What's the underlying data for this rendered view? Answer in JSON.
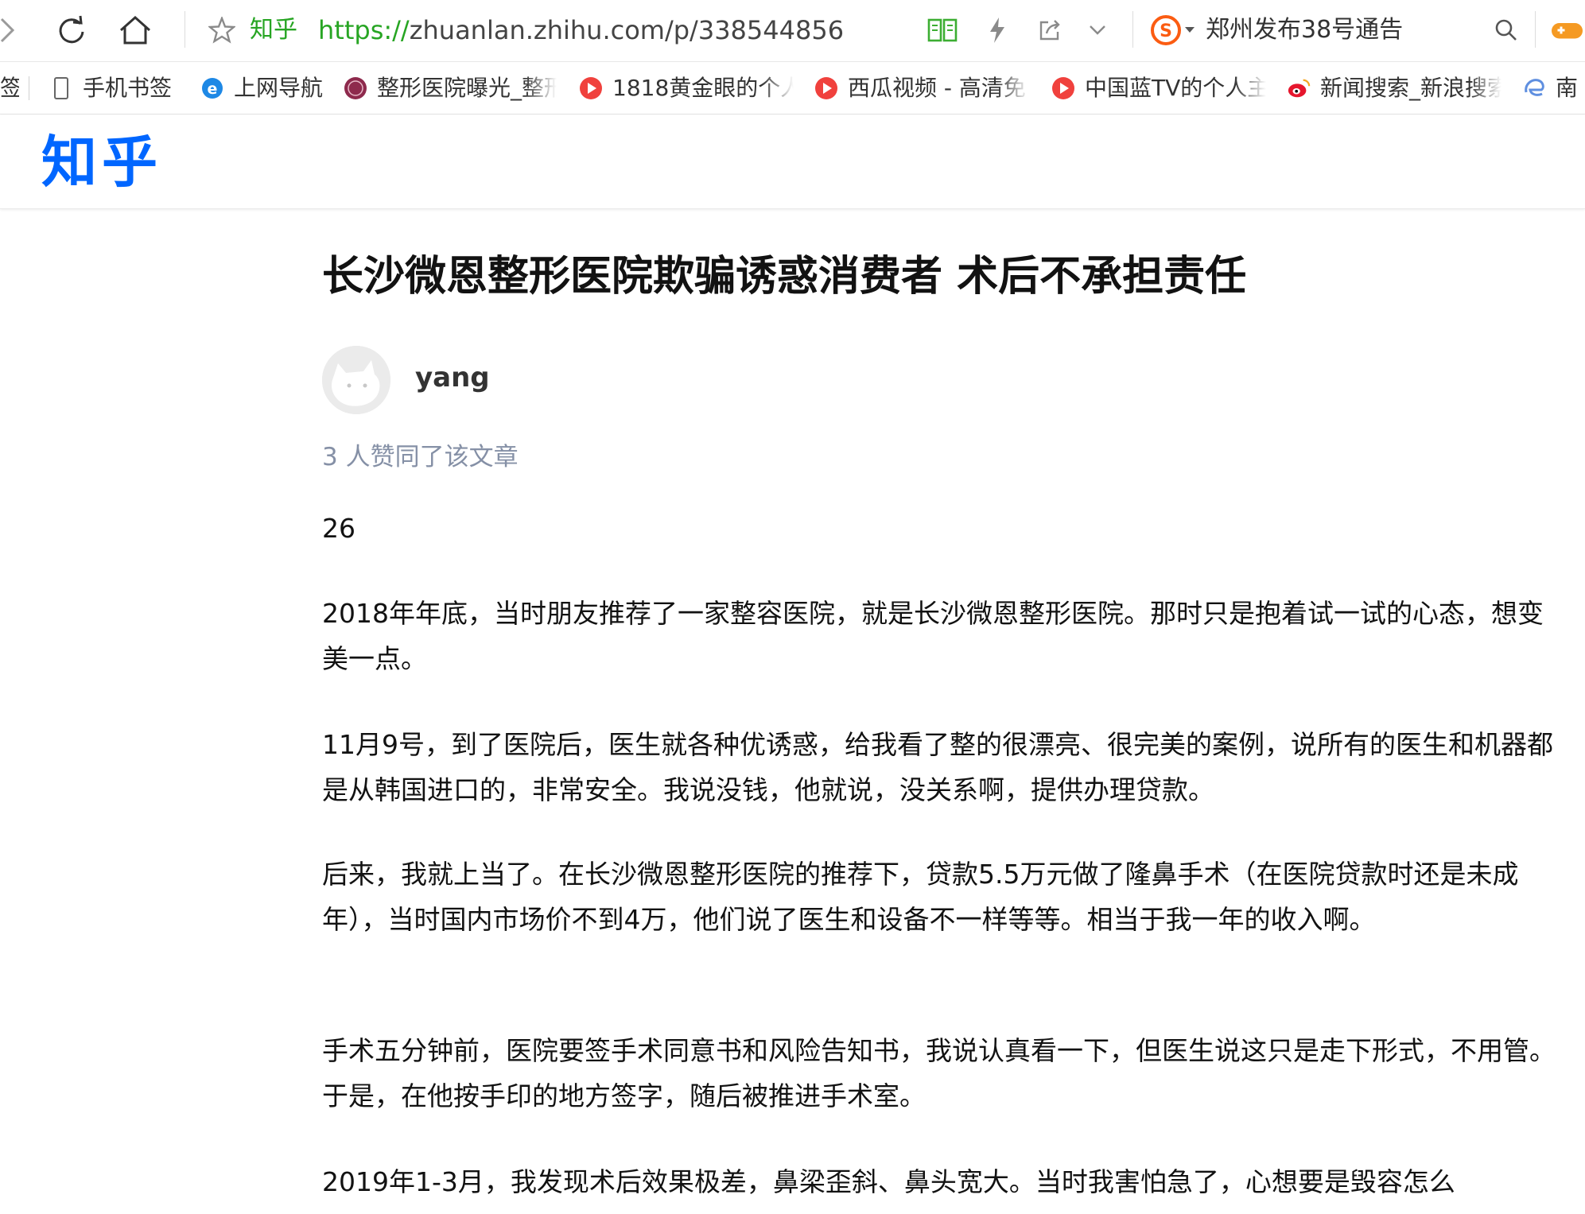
{
  "browser": {
    "site_name": "知乎",
    "url_scheme": "https://",
    "url_rest": "zhuanlan.zhihu.com/p/338544856",
    "search_hint": "郑州发布38号通告"
  },
  "bookmarks": [
    {
      "label": "签",
      "icon": "bookmark-icon"
    },
    {
      "label": "手机书签",
      "icon": "phone-icon"
    },
    {
      "label": "上网导航",
      "icon": "ie-icon"
    },
    {
      "label": "整形医院曝光_整形",
      "icon": "hospital-logo-icon"
    },
    {
      "label": "1818黄金眼的个人",
      "icon": "video-play-icon"
    },
    {
      "label": "西瓜视频 - 高清免",
      "icon": "video-play-icon"
    },
    {
      "label": "中国蓝TV的个人主",
      "icon": "video-play-icon"
    },
    {
      "label": "新闻搜索_新浪搜索",
      "icon": "weibo-icon"
    },
    {
      "label": "南",
      "icon": "edge-icon"
    }
  ],
  "zhihu": {
    "logo": "知乎"
  },
  "article": {
    "title": "长沙微恩整形医院欺骗诱惑消费者 术后不承担责任",
    "author": "yang",
    "upvotes": "3 人赞同了该文章",
    "paragraphs": [
      "26",
      "2018年年底，当时朋友推荐了一家整容医院，就是长沙微恩整形医院。那时只是抱着试一试的心态，想变美一点。",
      "11月9号，到了医院后，医生就各种优诱惑，给我看了整的很漂亮、很完美的案例，说所有的医生和机器都是从韩国进口的，非常安全。我说没钱，他就说，没关系啊，提供办理贷款。",
      "后来，我就上当了。在长沙微恩整形医院的推荐下，贷款5.5万元做了隆鼻手术（在医院贷款时还是未成年），当时国内市场价不到4万，他们说了医生和设备不一样等等。相当于我一年的收入啊。",
      "手术五分钟前，医院要签手术同意书和风险告知书，我说认真看一下，但医生说这只是走下形式，不用管。于是，在他按手印的地方签字，随后被推进手术室。",
      "2019年1-3月，我发现术后效果极差，鼻梁歪斜、鼻头宽大。当时我害怕急了，心想要是毁容怎么"
    ]
  },
  "colors": {
    "zhihu_blue": "#0066ff",
    "url_green": "#27a523",
    "meta_gray": "#8590a6",
    "sogou_orange": "#fb5c12"
  }
}
